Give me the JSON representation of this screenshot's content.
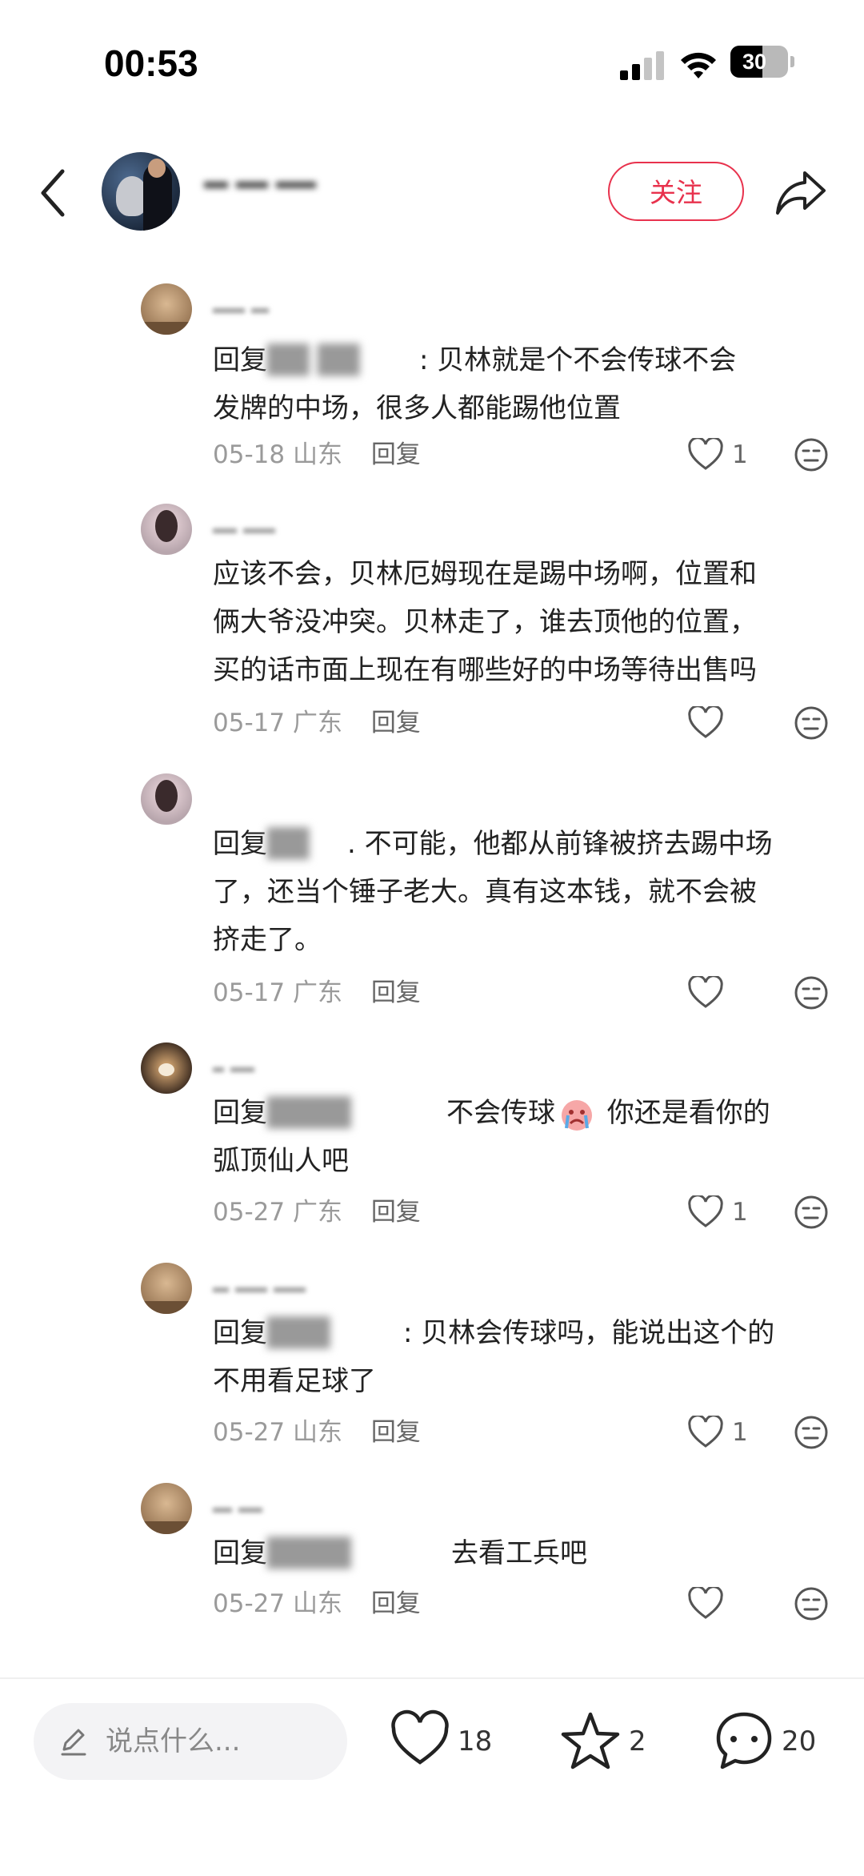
{
  "status_bar": {
    "time": "00:53",
    "battery": "30"
  },
  "header": {
    "author_name": "",
    "follow_label": "关注"
  },
  "comments": [
    {
      "avatar": "dog-avatar",
      "reply_prefix": "回复",
      "text_a": ": 贝林就是个不会传球不会",
      "text_b": "发牌的中场，很多人都能踢他位置",
      "date": "05-18",
      "location": "山东",
      "reply_label": "回复",
      "likes": "1"
    },
    {
      "avatar": "girl-avatar",
      "text_a": "应该不会，贝林厄姆现在是踢中场啊，位置和",
      "text_b": "俩大爷没冲突。贝林走了，谁去顶他的位置，",
      "text_c": "买的话市面上现在有哪些好的中场等待出售吗",
      "date": "05-17",
      "location": "广东",
      "reply_label": "回复",
      "likes": ""
    },
    {
      "avatar": "girl-avatar",
      "reply_prefix": "回复",
      "text_a": ". 不可能，他都从前锋被挤去踢中场",
      "text_b": "了，还当个锤子老大。真有这本钱，就不会被",
      "text_c": "挤走了。",
      "date": "05-17",
      "location": "广东",
      "reply_label": "回复",
      "likes": ""
    },
    {
      "avatar": "shiba-avatar",
      "reply_prefix": "回复",
      "text_a": "不会传球",
      "text_a2": " 你还是看你的",
      "text_b": "弧顶仙人吧",
      "date": "05-27",
      "location": "广东",
      "reply_label": "回复",
      "likes": "1"
    },
    {
      "avatar": "dog-avatar",
      "reply_prefix": "回复",
      "text_a": ": 贝林会传球吗，能说出这个的",
      "text_b": "不用看足球了",
      "date": "05-27",
      "location": "山东",
      "reply_label": "回复",
      "likes": "1"
    },
    {
      "avatar": "dog-avatar",
      "reply_prefix": "回复",
      "text_a": "去看工兵吧",
      "date": "05-27",
      "location": "山东",
      "reply_label": "回复",
      "likes": ""
    }
  ],
  "bottom_bar": {
    "input_placeholder": "说点什么...",
    "like_count": "18",
    "star_count": "2",
    "comment_count": "20"
  },
  "colors": {
    "accent": "#e8324d",
    "meta_gray": "#9a9a9a"
  }
}
